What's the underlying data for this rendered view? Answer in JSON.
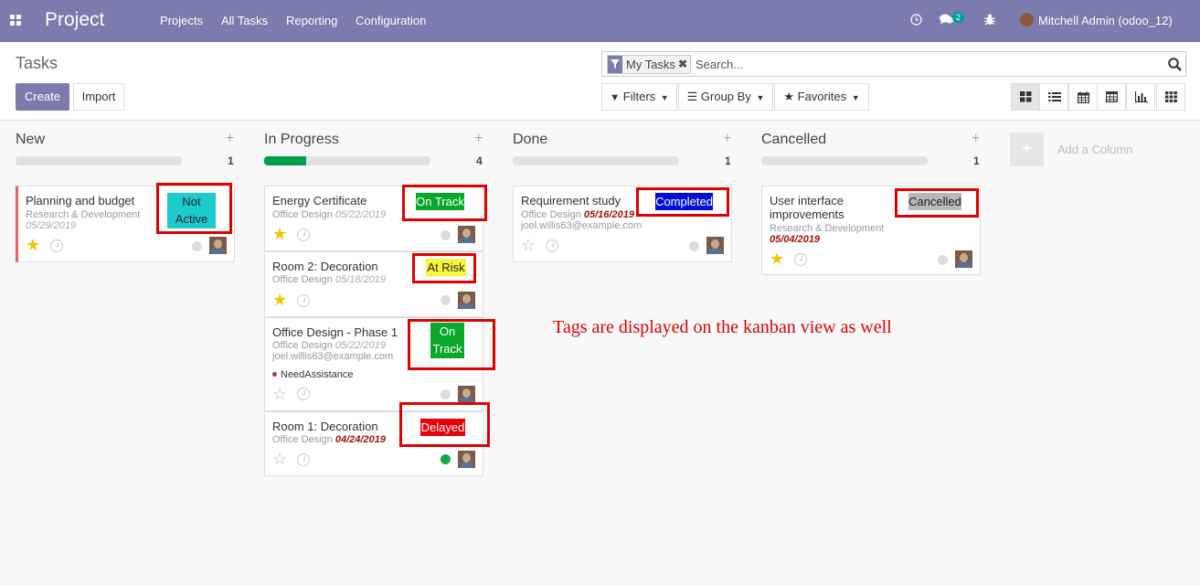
{
  "topbar": {
    "brand": "Project",
    "menu": [
      "Projects",
      "All Tasks",
      "Reporting",
      "Configuration"
    ],
    "icons": [
      "apps-icon",
      "clock-icon",
      "chat-icon",
      "bug-icon"
    ],
    "messages_badge": "2",
    "user": "Mitchell Admin (odoo_12)",
    "color": "#7c7bad"
  },
  "control": {
    "title": "Tasks",
    "create_label": "Create",
    "import_label": "Import",
    "facet_label": "My Tasks",
    "search_placeholder": "Search...",
    "filters_label": "Filters",
    "groupby_label": "Group By",
    "favorites_label": "Favorites",
    "views": [
      "kanban",
      "list",
      "calendar",
      "pivot",
      "graph",
      "grid"
    ]
  },
  "columns": [
    {
      "name": "New",
      "count": "1",
      "progress": 0
    },
    {
      "name": "In Progress",
      "count": "4",
      "progress": 0.25
    },
    {
      "name": "Done",
      "count": "1",
      "progress": 0
    },
    {
      "name": "Cancelled",
      "count": "1",
      "progress": 0
    }
  ],
  "cards": {
    "c1": {
      "title": "Planning and budget",
      "project": "Research & Development",
      "date": "05/29/2019",
      "tag_line1": "Not",
      "tag_line2": "Active",
      "starred": true,
      "state": "normal"
    },
    "c2": {
      "title": "Energy Certificate",
      "project": "Office Design",
      "date": "05/22/2019",
      "tag": "On Track",
      "starred": true,
      "state": "normal"
    },
    "c3": {
      "title": "Room 2: Decoration",
      "project": "Office Design",
      "date": "05/18/2019",
      "tag": "At Risk",
      "starred": true,
      "state": "normal"
    },
    "c4": {
      "title": "Office Design - Phase 1",
      "project": "Office Design",
      "date": "05/22/2019",
      "email": "joel.willis63@example.com",
      "label_tag": "NeedAssistance",
      "tag_line1": "On",
      "tag_line2": "Track",
      "starred": false,
      "state": "normal"
    },
    "c5": {
      "title": "Room 1: Decoration",
      "project": "Office Design",
      "date": "04/24/2019",
      "tag": "Delayed",
      "starred": false,
      "state": "done"
    },
    "c6": {
      "title": "Requirement study",
      "project": "Office Design",
      "date": "05/16/2019",
      "email": "joel.willis63@example.com",
      "tag": "Completed",
      "starred": false,
      "state": "normal"
    },
    "c7": {
      "title_line1": "User interface",
      "title_line2": "improvements",
      "project": "Research & Development",
      "date": "05/04/2019",
      "tag": "Cancelled",
      "starred": true,
      "state": "normal"
    }
  },
  "tag_colors": {
    "not_active": "#1ccccc",
    "on_track": "#0aa82a",
    "at_risk": "#f7f73a",
    "delayed": "#e8000a",
    "completed": "#0010d8",
    "cancelled": "#b8b8b8"
  },
  "add_column": "Add a Column",
  "annotation": "Tags are displayed on the kanban view as well"
}
